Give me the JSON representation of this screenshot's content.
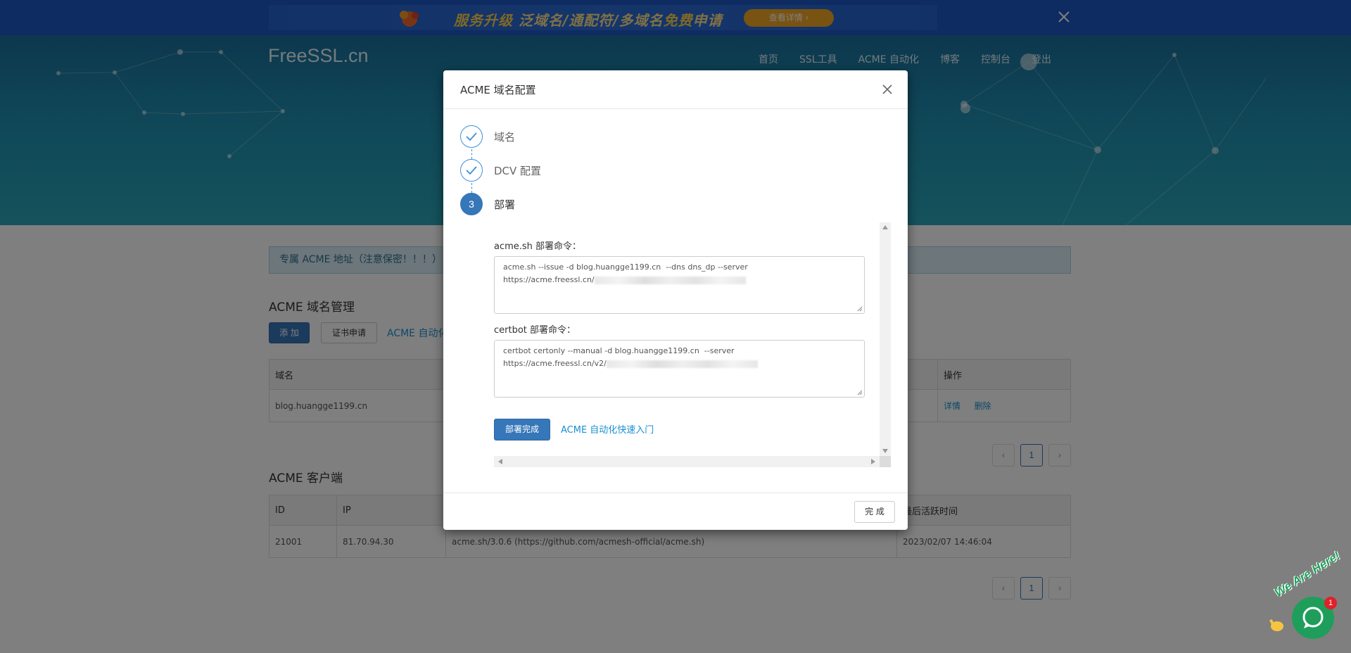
{
  "promo": {
    "text_1": "服务升级",
    "text_2": " 泛域名/通配符/多域名",
    "text_3": "免费",
    "text_4": "申请",
    "button": "查看详情 ›"
  },
  "header": {
    "logo": "FreeSSL.cn",
    "nav": [
      "首页",
      "SSL工具",
      "ACME 自动化",
      "博客",
      "控制台",
      "登出"
    ]
  },
  "alert": {
    "text": "专属 ACME 地址（注意保密！！！）"
  },
  "domains": {
    "title": "ACME 域名管理",
    "add_button": "添 加",
    "cert_button": "证书申请",
    "auto_link": "ACME 自动化",
    "columns": [
      "域名",
      "操作"
    ],
    "rows": [
      {
        "domain": "blog.huangge1199.cn",
        "action_detail": "详情",
        "action_delete": "删除"
      }
    ],
    "page": "1"
  },
  "clients": {
    "title": "ACME 客户端",
    "columns": [
      "ID",
      "IP",
      "",
      "最后活跃时间"
    ],
    "rows": [
      {
        "id": "21001",
        "ip": "81.70.94.30",
        "agent": "acme.sh/3.0.6 (https://github.com/acmesh-official/acme.sh)",
        "last_active": "2023/02/07 14:46:04"
      }
    ],
    "page": "1"
  },
  "modal": {
    "title": "ACME 域名配置",
    "steps": [
      {
        "label": "域名",
        "state": "done"
      },
      {
        "label": "DCV 配置",
        "state": "done"
      },
      {
        "label": "部署",
        "state": "active",
        "number": "3"
      }
    ],
    "acme_label": "acme.sh 部署命令：",
    "acme_cmd_1": "acme.sh --issue -d blog.huangge1199.cn  --dns dns_dp --server",
    "acme_cmd_2": "https://acme.freessl.cn/",
    "certbot_label": "certbot 部署命令：",
    "certbot_cmd_1": "certbot certonly --manual -d blog.huangge1199.cn  --server",
    "certbot_cmd_2": "https://acme.freessl.cn/v2/",
    "done_button": "部署完成",
    "guide_link": "ACME 自动化快速入门",
    "finish_button": "完 成"
  },
  "chat": {
    "text": "We Are Here!",
    "badge": "1"
  },
  "colors": {
    "primary": "#3677ba",
    "link": "#1a8fcf",
    "promo_bg": "#1c57c4",
    "chat": "#1e9e5a"
  }
}
